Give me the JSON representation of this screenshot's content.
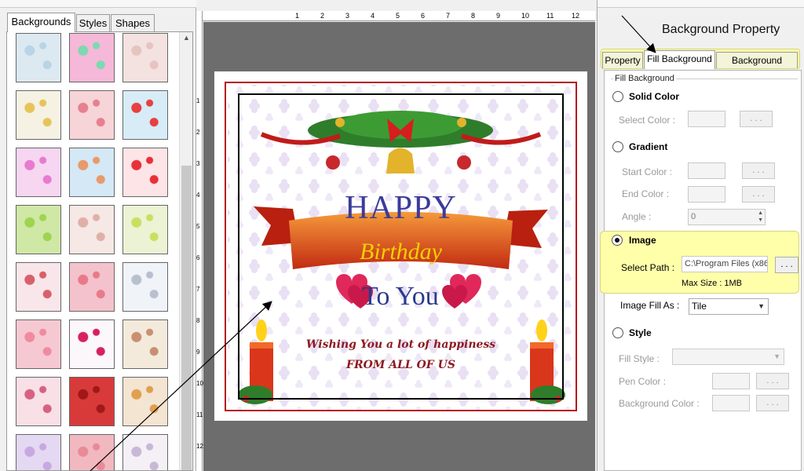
{
  "left_panel": {
    "tabs": [
      {
        "label": "Backgrounds",
        "active": true
      },
      {
        "label": "Styles",
        "active": false
      },
      {
        "label": "Shapes",
        "active": false
      }
    ]
  },
  "ruler": {
    "top_numbers": [
      "1",
      "2",
      "3",
      "4",
      "5",
      "6",
      "7",
      "8",
      "9",
      "10",
      "11",
      "12"
    ],
    "left_numbers": [
      "1",
      "2",
      "3",
      "4",
      "5",
      "6",
      "7",
      "8",
      "9",
      "10",
      "11",
      "12"
    ]
  },
  "card": {
    "line1": "HAPPY",
    "line2": "Birthday",
    "line3": "To You",
    "wish": "Wishing You a lot of happiness",
    "from": "FROM ALL OF US"
  },
  "right_panel": {
    "annotation": "Background Property",
    "tabs": [
      {
        "label": "Property",
        "active": false
      },
      {
        "label": "Fill Background",
        "active": true
      },
      {
        "label": "Background Effects",
        "active": false
      }
    ],
    "group_title": "Fill Background",
    "solid_color": {
      "label": "Solid Color",
      "select_color": "Select Color :",
      "button": ". . ."
    },
    "gradient": {
      "label": "Gradient",
      "start_color": "Start Color :",
      "end_color": "End Color :",
      "angle": "Angle :",
      "angle_value": "0",
      "button": ". . ."
    },
    "image": {
      "label": "Image",
      "select_path": "Select Path :",
      "path_value": "C:\\Program Files (x86",
      "max_size": "Max Size : 1MB",
      "fill_as": "Image Fill As :",
      "fill_value": "Tile",
      "button": ". . ."
    },
    "style": {
      "label": "Style",
      "fill_style": "Fill Style :",
      "pen_color": "Pen Color :",
      "background_color": "Background Color :",
      "button": ". . ."
    },
    "selected_option": "Image"
  }
}
